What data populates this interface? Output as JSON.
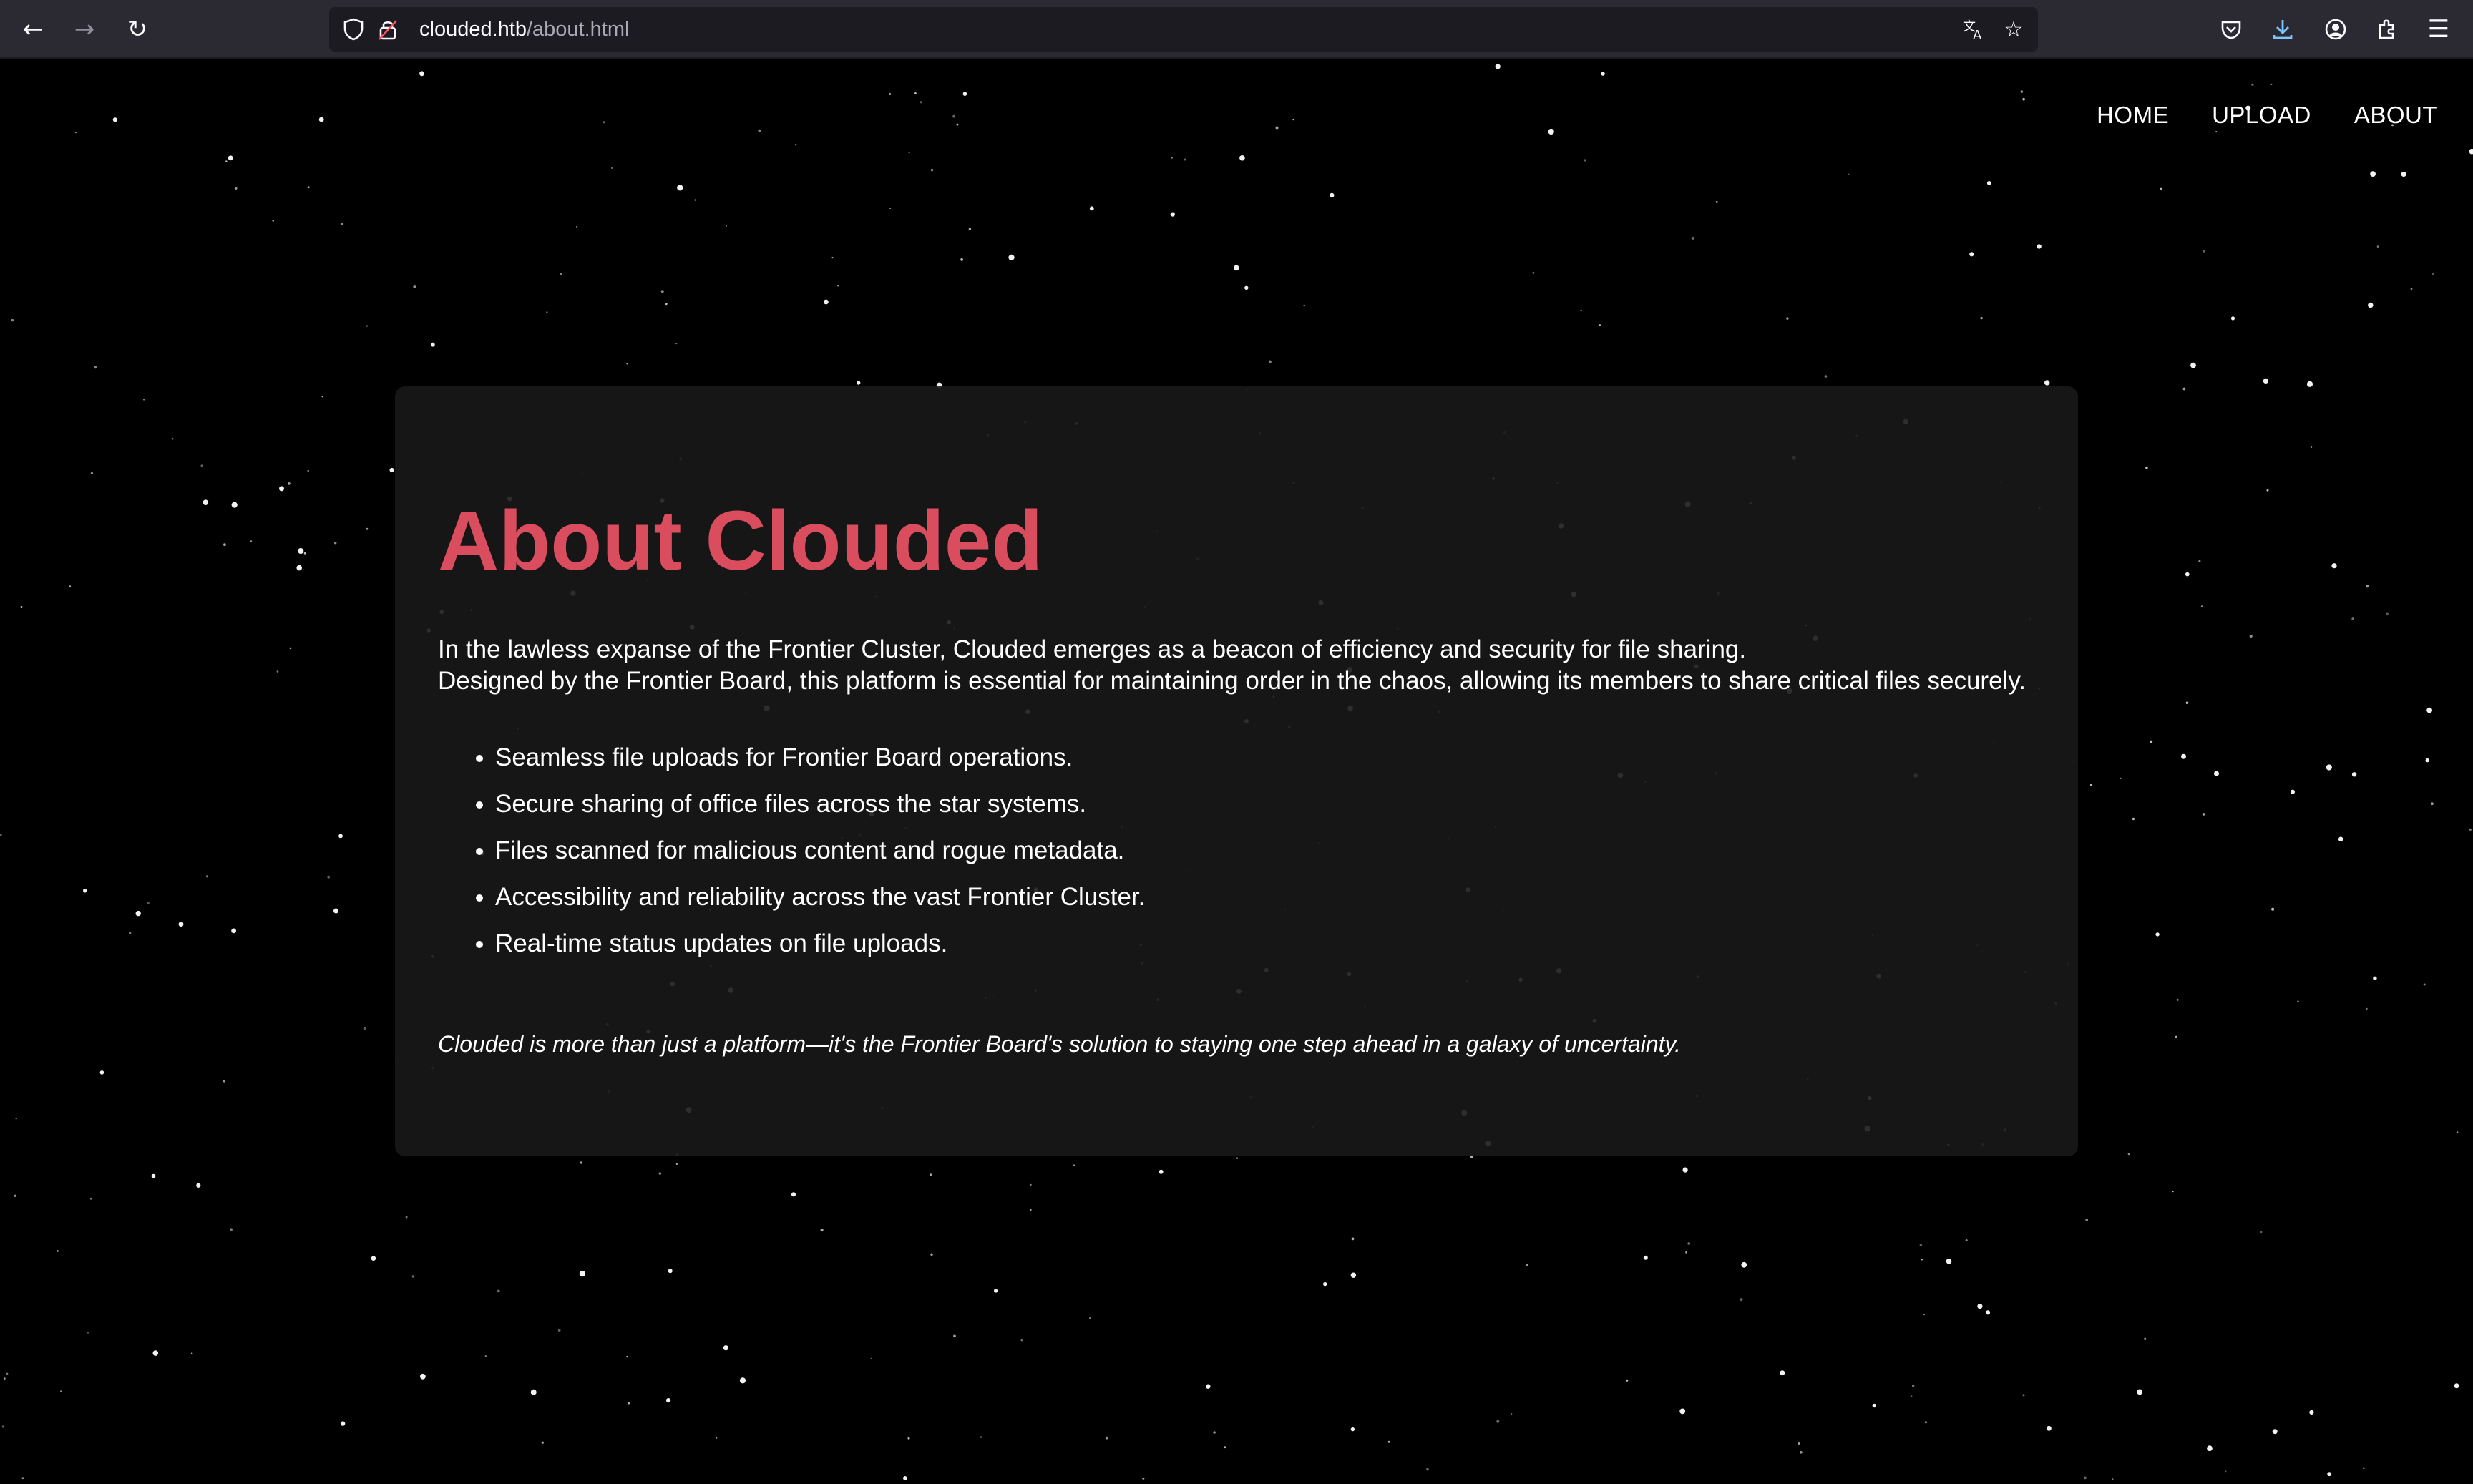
{
  "browser": {
    "url_host": "clouded.htb",
    "url_path": "/about.html",
    "icons": {
      "back": "back-arrow-icon",
      "forward": "forward-arrow-icon",
      "reload": "reload-icon",
      "shield": "tracking-shield-icon",
      "lock": "insecure-lock-icon",
      "translate": "translate-icon",
      "bookmark": "bookmark-star-icon",
      "pocket": "pocket-icon",
      "downloads": "downloads-icon",
      "account": "account-icon",
      "extensions": "extensions-icon",
      "menu": "hamburger-menu-icon"
    }
  },
  "nav": {
    "items": [
      {
        "label": "HOME"
      },
      {
        "label": "UPLOAD"
      },
      {
        "label": "ABOUT"
      }
    ]
  },
  "about": {
    "title": "About Clouded",
    "intro_line_1": "In the lawless expanse of the Frontier Cluster, Clouded emerges as a beacon of efficiency and security for file sharing.",
    "intro_line_2": "Designed by the Frontier Board, this platform is essential for maintaining order in the chaos, allowing its members to share critical files securely.",
    "features": [
      "Seamless file uploads for Frontier Board operations.",
      "Secure sharing of office files across the star systems.",
      "Files scanned for malicious content and rogue metadata.",
      "Accessibility and reliability across the vast Frontier Cluster.",
      "Real-time status updates on file uploads."
    ],
    "tagline": "Clouded is more than just a platform—it's the Frontier Board's solution to staying one step ahead in a galaxy of uncertainty."
  },
  "colors": {
    "accent": "#d94d5f",
    "background": "#000000",
    "card": "#18181a",
    "download_accent": "#7cc7ff"
  }
}
